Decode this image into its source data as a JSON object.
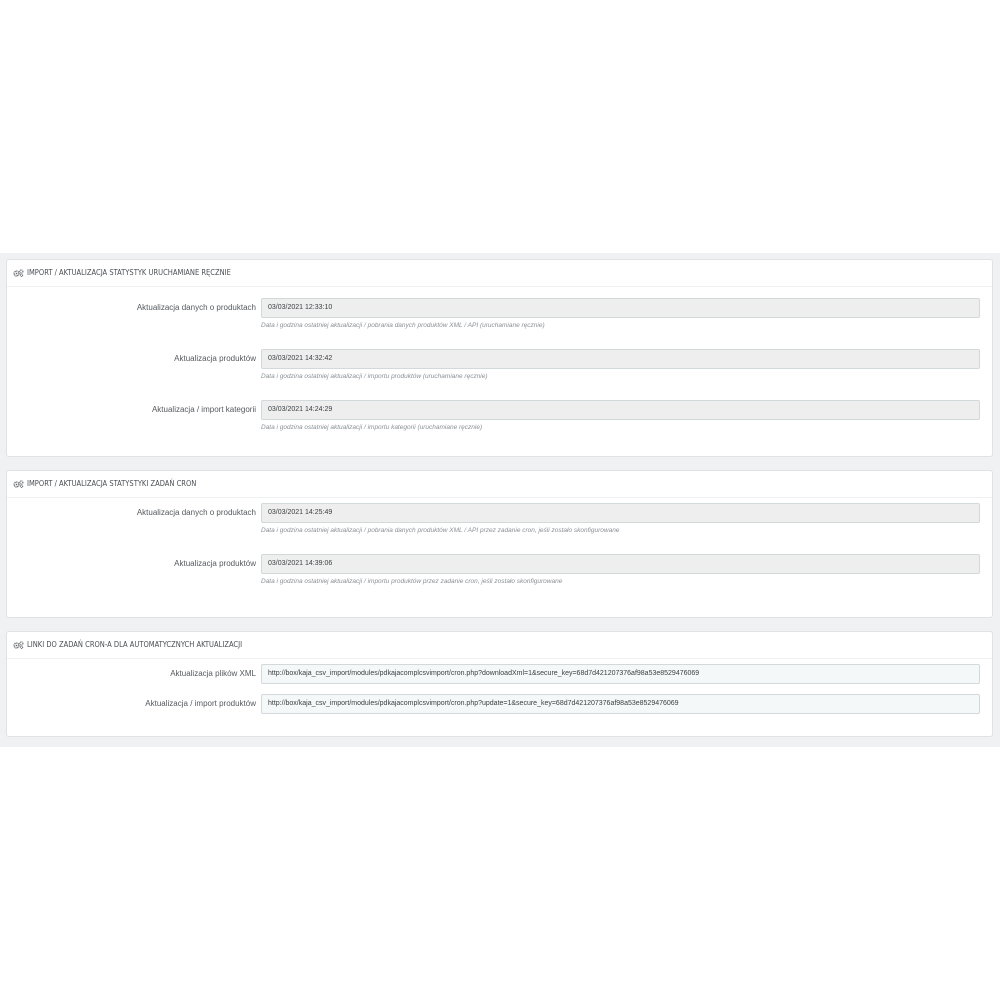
{
  "panels": {
    "manual": {
      "title": "IMPORT / AKTUALIZACJA STATYSTYK URUCHAMIANE RĘCZNIE",
      "rows": [
        {
          "label": "Aktualizacja danych o produktach",
          "value": "03/03/2021 12:33:10",
          "help": "Data i godzina ostatniej aktualizacji / pobrania danych produktów XML / API (uruchamiane ręcznie)"
        },
        {
          "label": "Aktualizacja produktów",
          "value": "03/03/2021 14:32:42",
          "help": "Data i godzina ostatniej aktualizacji / importu produktów (uruchamiane ręcznie)"
        },
        {
          "label": "Aktualizacja / import kategorii",
          "value": "03/03/2021 14:24:29",
          "help": "Data i godzina ostatniej aktualizacji / importu kategorii (uruchamiane ręcznie)"
        }
      ]
    },
    "cron": {
      "title": "IMPORT / AKTUALIZACJA STATYSTYKI ZADAŃ CRON",
      "rows": [
        {
          "label": "Aktualizacja danych o produktach",
          "value": "03/03/2021 14:25:49",
          "help": "Data i godzina ostatniej aktualizacji / pobrania danych produktów XML / API przez zadanie cron, jeśli zostało skonfigurowane"
        },
        {
          "label": "Aktualizacja produktów",
          "value": "03/03/2021 14:39:06",
          "help": "Data i godzina ostatniej aktualizacji / importu produktów przez zadanie cron, jeśli zostało skonfigurowane"
        }
      ]
    },
    "links": {
      "title": "LINKI DO ZADAŃ CRON-A DLA AUTOMATYCZNYCH AKTUALIZACJI",
      "rows": [
        {
          "label": "Aktualizacja plików XML",
          "value": "http://box/kaja_csv_import/modules/pdkajacomplcsvimport/cron.php?downloadXml=1&secure_key=68d7d421207376af98a53e8529476069"
        },
        {
          "label": "Aktualizacja / import produktów",
          "value": "http://box/kaja_csv_import/modules/pdkajacomplcsvimport/cron.php?update=1&secure_key=68d7d421207376af98a53e8529476069"
        }
      ]
    }
  },
  "icons": {
    "panel_heading": "cogs-icon"
  },
  "colors": {
    "page_background": "#eff1f2",
    "readonly_field": "#eeeeee",
    "help_text": "#8a9094"
  }
}
